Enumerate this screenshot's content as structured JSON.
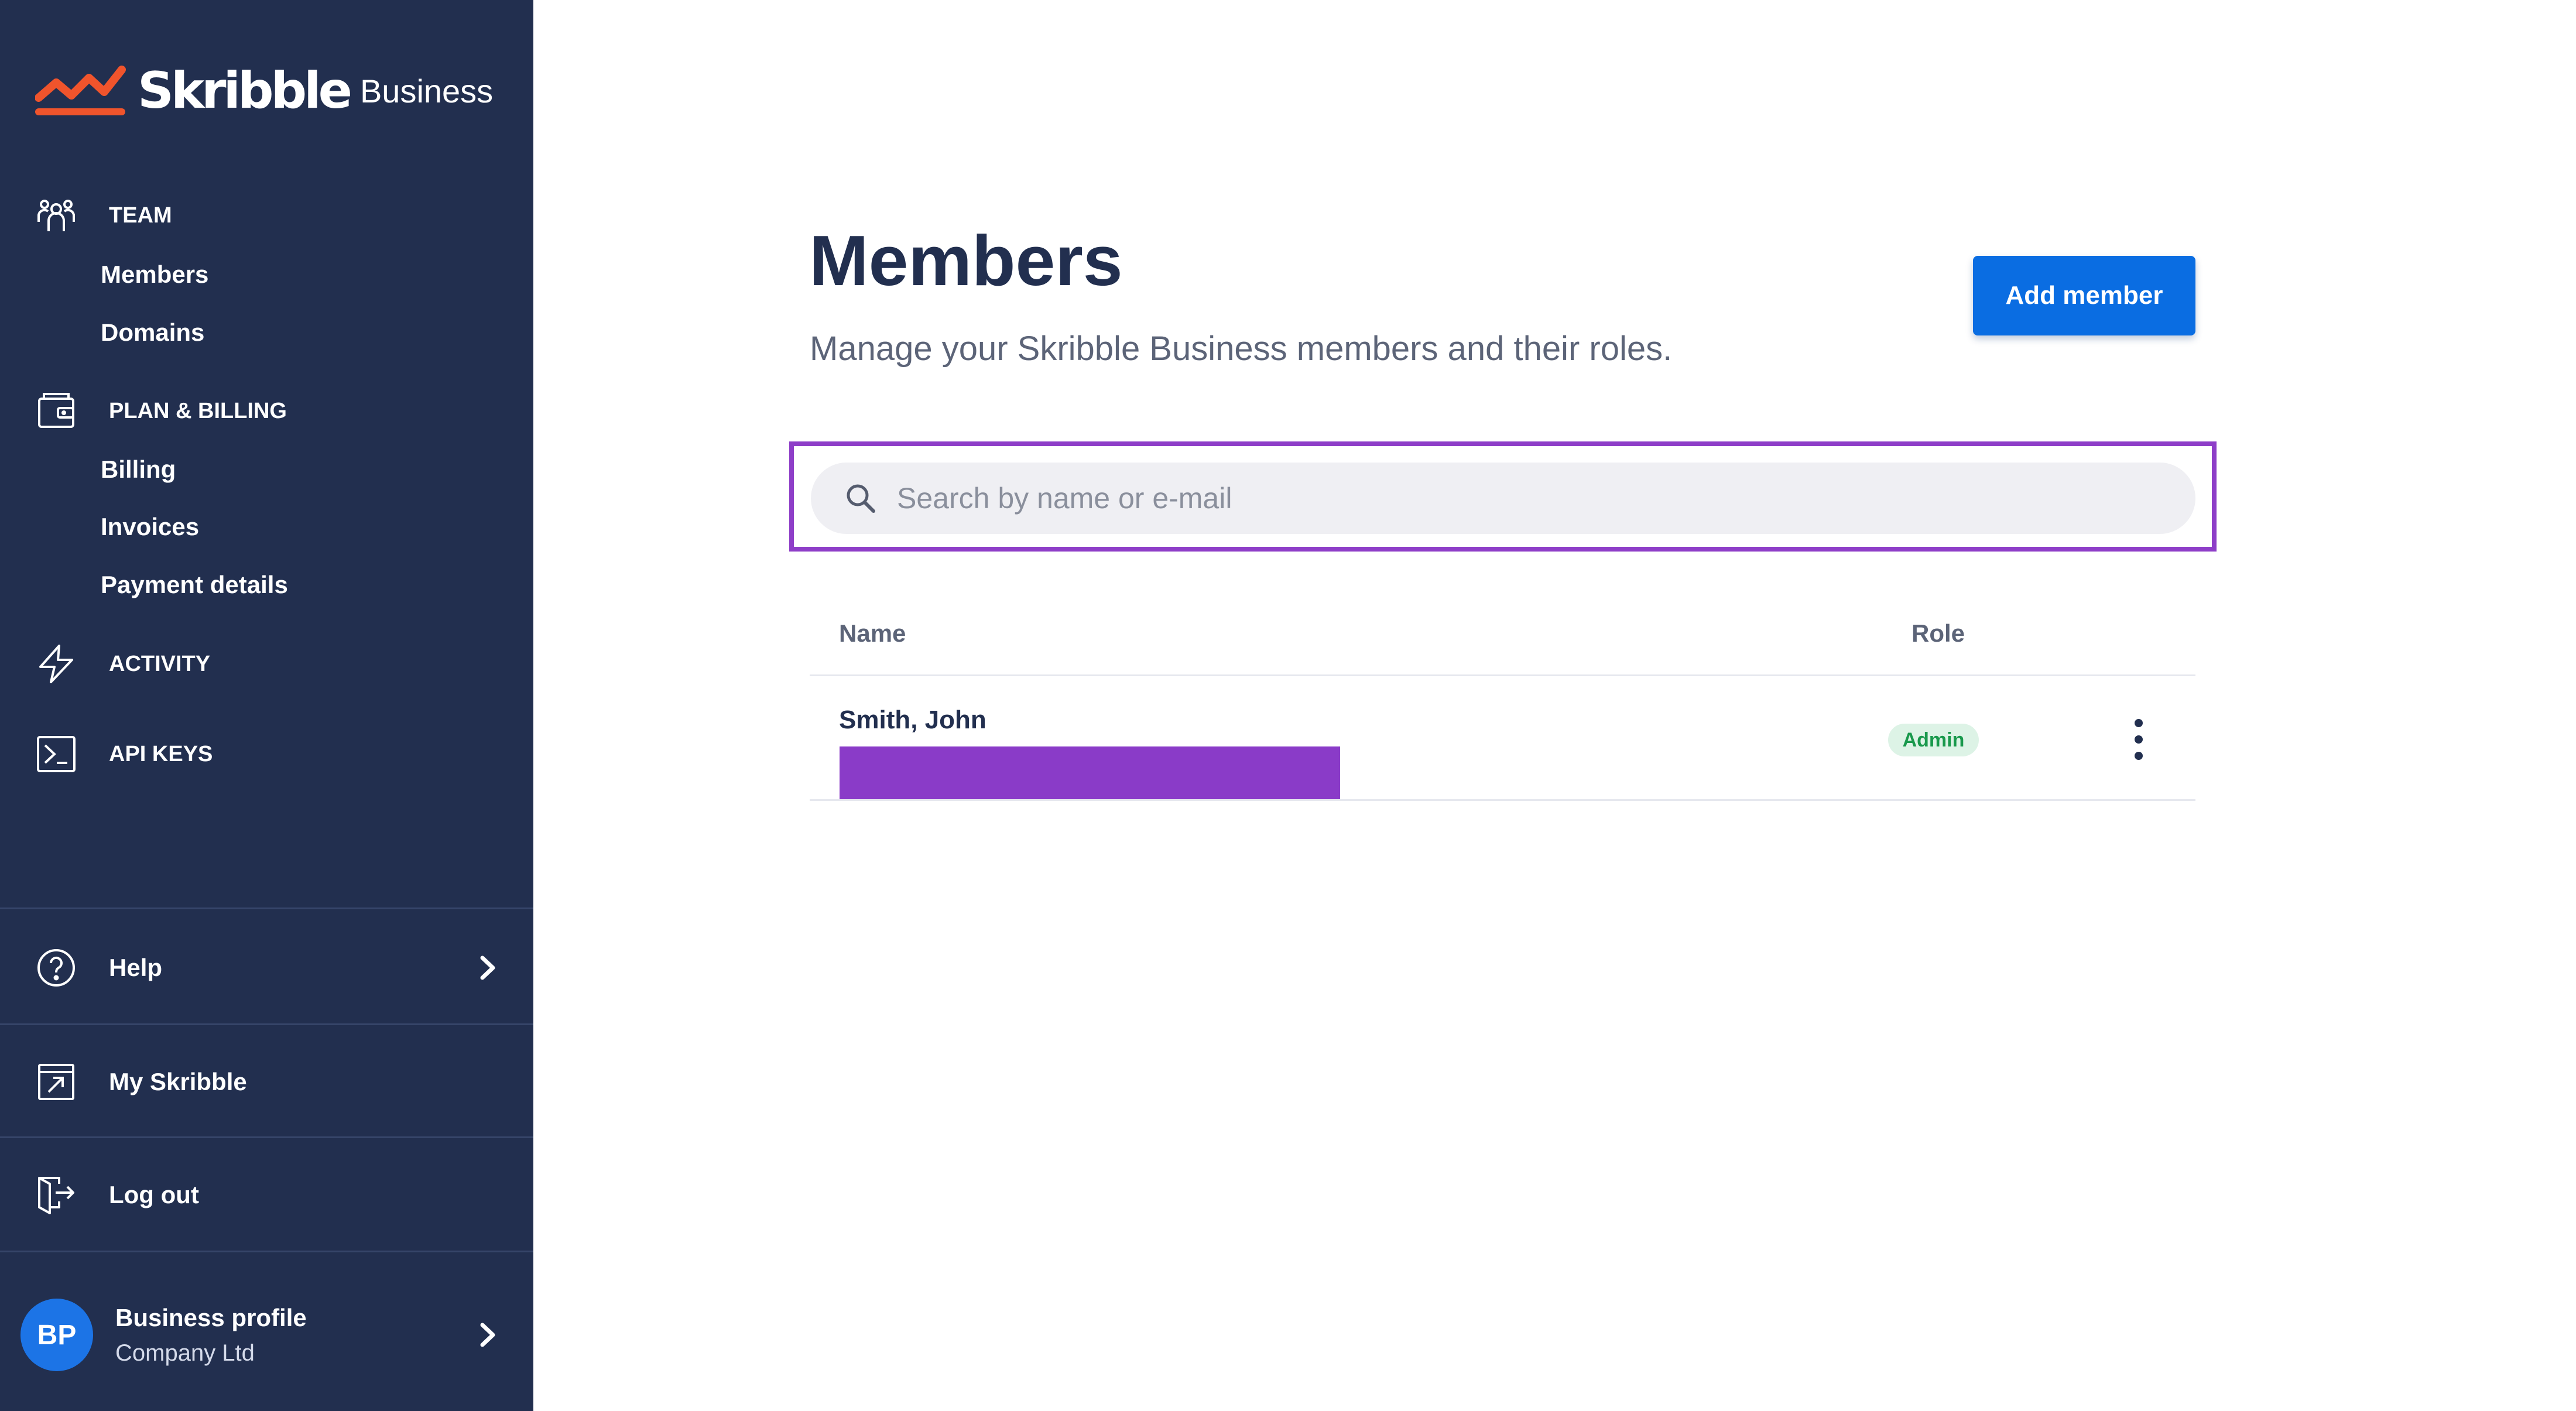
{
  "brand": {
    "name": "Skribble",
    "product": "Business",
    "accent_color": "#f0542c"
  },
  "sidebar": {
    "sections": [
      {
        "label": "TEAM",
        "icon": "team-icon",
        "items": [
          "Members",
          "Domains"
        ]
      },
      {
        "label": "PLAN & BILLING",
        "icon": "wallet-icon",
        "items": [
          "Billing",
          "Invoices",
          "Payment details"
        ]
      },
      {
        "label": "ACTIVITY",
        "icon": "lightning-icon",
        "items": []
      },
      {
        "label": "API KEYS",
        "icon": "terminal-icon",
        "items": []
      }
    ],
    "footer": {
      "help": "Help",
      "my_skribble": "My Skribble",
      "logout": "Log out"
    },
    "profile": {
      "initials": "BP",
      "name": "Business profile",
      "company": "Company Ltd"
    }
  },
  "main": {
    "title": "Members",
    "subtitle": "Manage your Skribble Business members and their roles.",
    "add_button": "Add member",
    "search": {
      "placeholder": "Search by name or e-mail",
      "value": ""
    },
    "table": {
      "columns": [
        "Name",
        "Role"
      ],
      "rows": [
        {
          "name": "Smith, John",
          "role": "Admin"
        }
      ]
    }
  },
  "colors": {
    "sidebar_bg": "#222f4f",
    "primary_button": "#0a6de2",
    "highlight": "#8e3ec8",
    "badge_bg": "#ddf3e6",
    "badge_text": "#19994c"
  }
}
